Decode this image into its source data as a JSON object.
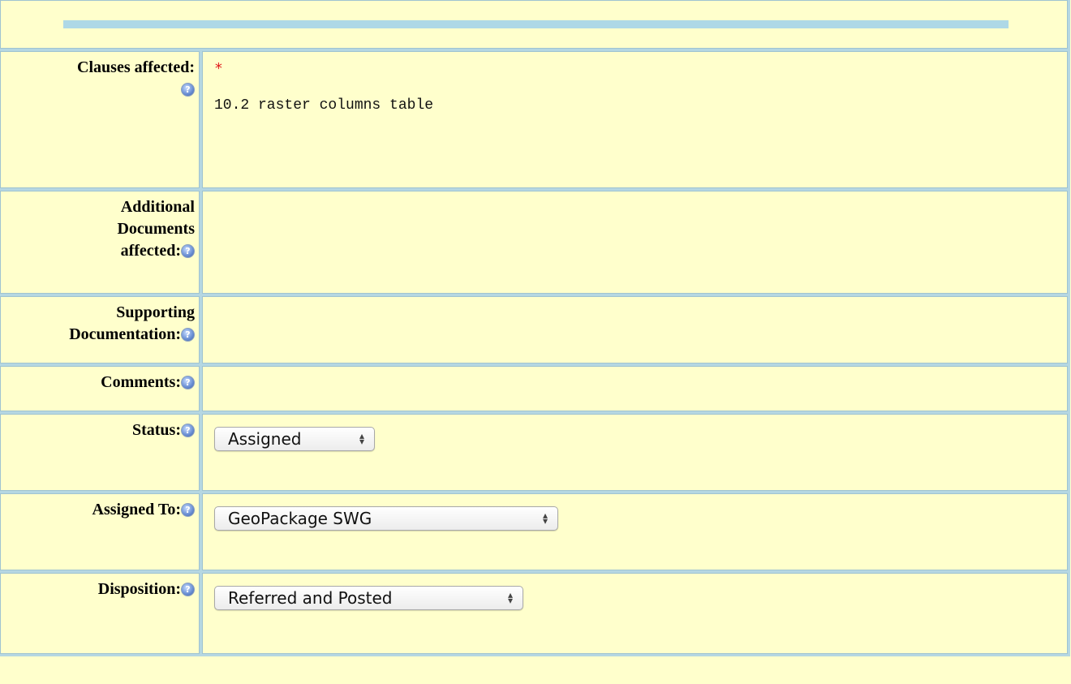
{
  "title_bar": {},
  "rows": {
    "clauses": {
      "label": "Clauses affected:",
      "required_marker": "*",
      "value": "10.2 raster columns table"
    },
    "additional": {
      "label_line1": "Additional",
      "label_line2": "Documents",
      "label_line3": "affected:"
    },
    "supporting": {
      "label_line1": "Supporting",
      "label_line2": "Documentation:"
    },
    "comments": {
      "label": "Comments:"
    },
    "status": {
      "label": "Status:",
      "selected": "Assigned"
    },
    "assigned_to": {
      "label": "Assigned To:",
      "selected": "GeoPackage SWG"
    },
    "disposition": {
      "label": "Disposition:",
      "selected": "Referred and Posted"
    }
  },
  "icons": {
    "help": "help-icon",
    "select_arrows": "updown-arrows-icon"
  },
  "colors": {
    "background": "#ffffcc",
    "border": "#b5d7e2",
    "accent_bar": "#aed8e6",
    "required": "#e01c1c"
  }
}
